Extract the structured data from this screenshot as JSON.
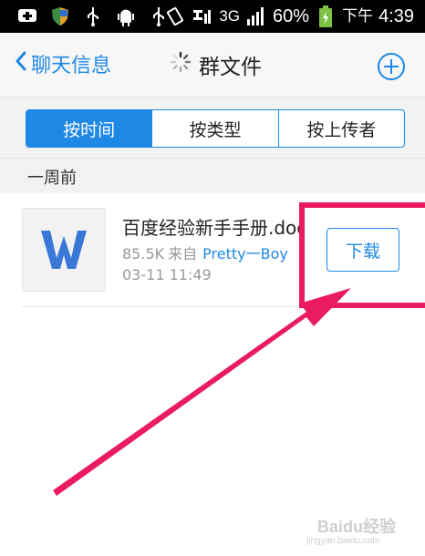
{
  "status_bar": {
    "network": "3G",
    "battery_percent": "60%",
    "time_period": "下午",
    "time": "4:39"
  },
  "header": {
    "back_label": "聊天信息",
    "title": "群文件"
  },
  "tabs": [
    {
      "label": "按时间",
      "active": true
    },
    {
      "label": "按类型",
      "active": false
    },
    {
      "label": "按上传者",
      "active": false
    }
  ],
  "section": {
    "label": "一周前"
  },
  "files": [
    {
      "name": "百度经验新手手册.doc",
      "size": "85.5K",
      "from_label": "来自",
      "uploader": "Pretty一Boy",
      "time": "03-11 11:49",
      "download_label": "下载"
    }
  ],
  "watermark": {
    "logo_text": "Baidu经验",
    "url": "jingyan.baidu.com"
  },
  "colors": {
    "accent": "#1e88e5",
    "annotation": "#ea1b63"
  }
}
